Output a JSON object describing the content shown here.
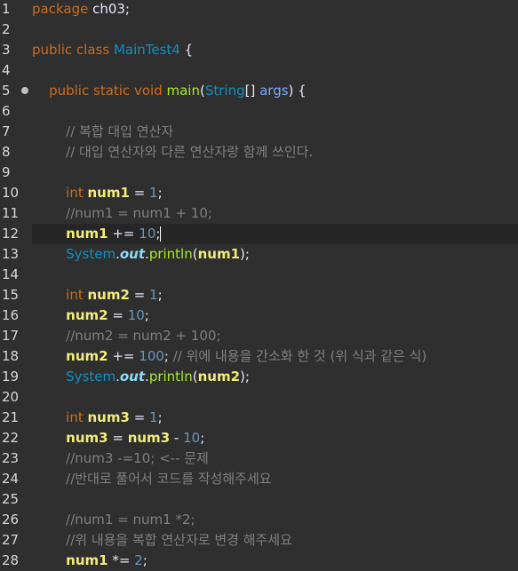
{
  "lines": [
    {
      "n": "1",
      "tokens": [
        {
          "c": "t-kw",
          "t": "package"
        },
        {
          "c": "t-plain",
          "t": " ch03;"
        }
      ]
    },
    {
      "n": "2",
      "tokens": []
    },
    {
      "n": "3",
      "tokens": [
        {
          "c": "t-kw",
          "t": "public"
        },
        {
          "c": "t-plain",
          "t": " "
        },
        {
          "c": "t-kw",
          "t": "class"
        },
        {
          "c": "t-plain",
          "t": " "
        },
        {
          "c": "t-cls",
          "t": "MainTest4"
        },
        {
          "c": "t-plain",
          "t": " {"
        }
      ]
    },
    {
      "n": "4",
      "tokens": []
    },
    {
      "n": "5",
      "fold": true,
      "tokens": [
        {
          "c": "t-plain",
          "t": "    "
        },
        {
          "c": "t-kw",
          "t": "public"
        },
        {
          "c": "t-plain",
          "t": " "
        },
        {
          "c": "t-kw",
          "t": "static"
        },
        {
          "c": "t-plain",
          "t": " "
        },
        {
          "c": "t-kw",
          "t": "void"
        },
        {
          "c": "t-plain",
          "t": " "
        },
        {
          "c": "t-fn",
          "t": "main"
        },
        {
          "c": "t-plain",
          "t": "("
        },
        {
          "c": "t-cls",
          "t": "String"
        },
        {
          "c": "t-plain",
          "t": "[] "
        },
        {
          "c": "t-args",
          "t": "args"
        },
        {
          "c": "t-plain",
          "t": ") {"
        }
      ]
    },
    {
      "n": "6",
      "tokens": []
    },
    {
      "n": "7",
      "tokens": [
        {
          "c": "t-plain",
          "t": "        "
        },
        {
          "c": "t-com",
          "t": "// 복합 대입 연산자"
        }
      ]
    },
    {
      "n": "8",
      "tokens": [
        {
          "c": "t-plain",
          "t": "        "
        },
        {
          "c": "t-com",
          "t": "// 대입 연산자와 다른 연산자랑 함께 쓰인다."
        }
      ]
    },
    {
      "n": "9",
      "tokens": []
    },
    {
      "n": "10",
      "tokens": [
        {
          "c": "t-plain",
          "t": "        "
        },
        {
          "c": "t-kw",
          "t": "int"
        },
        {
          "c": "t-plain",
          "t": " "
        },
        {
          "c": "t-var",
          "t": "num1"
        },
        {
          "c": "t-plain",
          "t": " = "
        },
        {
          "c": "t-num",
          "t": "1"
        },
        {
          "c": "t-plain",
          "t": ";"
        }
      ]
    },
    {
      "n": "11",
      "tokens": [
        {
          "c": "t-plain",
          "t": "        "
        },
        {
          "c": "t-com",
          "t": "//num1 = num1 + 10;"
        }
      ]
    },
    {
      "n": "12",
      "current": true,
      "tokens": [
        {
          "c": "t-plain",
          "t": "        "
        },
        {
          "c": "t-var",
          "t": "num1"
        },
        {
          "c": "t-plain",
          "t": " += "
        },
        {
          "c": "t-num",
          "t": "10"
        },
        {
          "c": "t-plain",
          "t": ";"
        },
        {
          "c": "caret",
          "t": ""
        }
      ]
    },
    {
      "n": "13",
      "tokens": [
        {
          "c": "t-plain",
          "t": "        "
        },
        {
          "c": "t-cls",
          "t": "System"
        },
        {
          "c": "t-plain",
          "t": "."
        },
        {
          "c": "t-static",
          "t": "out"
        },
        {
          "c": "t-plain",
          "t": "."
        },
        {
          "c": "t-fn",
          "t": "println"
        },
        {
          "c": "t-plain",
          "t": "("
        },
        {
          "c": "t-var",
          "t": "num1"
        },
        {
          "c": "t-plain",
          "t": ");"
        }
      ]
    },
    {
      "n": "14",
      "tokens": []
    },
    {
      "n": "15",
      "tokens": [
        {
          "c": "t-plain",
          "t": "        "
        },
        {
          "c": "t-kw",
          "t": "int"
        },
        {
          "c": "t-plain",
          "t": " "
        },
        {
          "c": "t-var",
          "t": "num2"
        },
        {
          "c": "t-plain",
          "t": " = "
        },
        {
          "c": "t-num",
          "t": "1"
        },
        {
          "c": "t-plain",
          "t": ";"
        }
      ]
    },
    {
      "n": "16",
      "tokens": [
        {
          "c": "t-plain",
          "t": "        "
        },
        {
          "c": "t-var",
          "t": "num2"
        },
        {
          "c": "t-plain",
          "t": " = "
        },
        {
          "c": "t-num",
          "t": "10"
        },
        {
          "c": "t-plain",
          "t": ";"
        }
      ]
    },
    {
      "n": "17",
      "tokens": [
        {
          "c": "t-plain",
          "t": "        "
        },
        {
          "c": "t-com",
          "t": "//num2 = num2 + 100;"
        }
      ]
    },
    {
      "n": "18",
      "tokens": [
        {
          "c": "t-plain",
          "t": "        "
        },
        {
          "c": "t-var",
          "t": "num2"
        },
        {
          "c": "t-plain",
          "t": " += "
        },
        {
          "c": "t-num",
          "t": "100"
        },
        {
          "c": "t-plain",
          "t": "; "
        },
        {
          "c": "t-com",
          "t": "// 위에 내용을 간소화 한 것 (위 식과 같은 식)"
        }
      ]
    },
    {
      "n": "19",
      "tokens": [
        {
          "c": "t-plain",
          "t": "        "
        },
        {
          "c": "t-cls",
          "t": "System"
        },
        {
          "c": "t-plain",
          "t": "."
        },
        {
          "c": "t-static",
          "t": "out"
        },
        {
          "c": "t-plain",
          "t": "."
        },
        {
          "c": "t-fn",
          "t": "println"
        },
        {
          "c": "t-plain",
          "t": "("
        },
        {
          "c": "t-var",
          "t": "num2"
        },
        {
          "c": "t-plain",
          "t": ");"
        }
      ]
    },
    {
      "n": "20",
      "tokens": []
    },
    {
      "n": "21",
      "tokens": [
        {
          "c": "t-plain",
          "t": "        "
        },
        {
          "c": "t-kw",
          "t": "int"
        },
        {
          "c": "t-plain",
          "t": " "
        },
        {
          "c": "t-var",
          "t": "num3"
        },
        {
          "c": "t-plain",
          "t": " = "
        },
        {
          "c": "t-num",
          "t": "1"
        },
        {
          "c": "t-plain",
          "t": ";"
        }
      ]
    },
    {
      "n": "22",
      "tokens": [
        {
          "c": "t-plain",
          "t": "        "
        },
        {
          "c": "t-var",
          "t": "num3"
        },
        {
          "c": "t-plain",
          "t": " = "
        },
        {
          "c": "t-var",
          "t": "num3"
        },
        {
          "c": "t-plain",
          "t": " - "
        },
        {
          "c": "t-num",
          "t": "10"
        },
        {
          "c": "t-plain",
          "t": ";"
        }
      ]
    },
    {
      "n": "23",
      "tokens": [
        {
          "c": "t-plain",
          "t": "        "
        },
        {
          "c": "t-com",
          "t": "//num3 -=10; <-- 문제"
        }
      ]
    },
    {
      "n": "24",
      "tokens": [
        {
          "c": "t-plain",
          "t": "        "
        },
        {
          "c": "t-com",
          "t": "//반대로 풀어서 코드를 작성해주세요"
        }
      ]
    },
    {
      "n": "25",
      "tokens": []
    },
    {
      "n": "26",
      "tokens": [
        {
          "c": "t-plain",
          "t": "        "
        },
        {
          "c": "t-com",
          "t": "//num1 = num1 *2;"
        }
      ]
    },
    {
      "n": "27",
      "tokens": [
        {
          "c": "t-plain",
          "t": "        "
        },
        {
          "c": "t-com",
          "t": "//위 내용을 복합 연산자로 변경 해주세요"
        }
      ]
    },
    {
      "n": "28",
      "tokens": [
        {
          "c": "t-plain",
          "t": "        "
        },
        {
          "c": "t-var",
          "t": "num1"
        },
        {
          "c": "t-plain",
          "t": " *= "
        },
        {
          "c": "t-num",
          "t": "2"
        },
        {
          "c": "t-plain",
          "t": ";"
        }
      ]
    }
  ]
}
